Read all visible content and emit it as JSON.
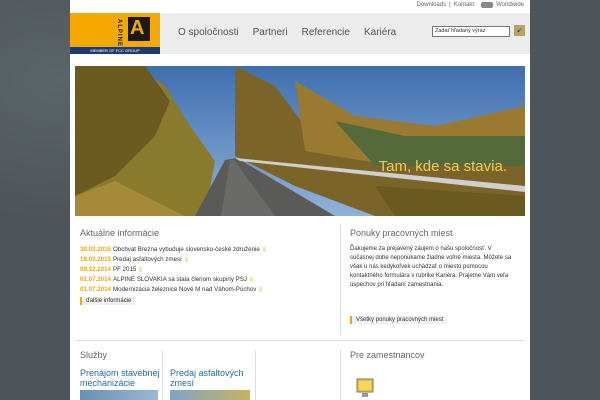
{
  "toplinks": {
    "downloads": "Downloads",
    "sep": "|",
    "contact": "Kontakt",
    "worldwide": "Worldwide"
  },
  "logo": {
    "name": "ALPINE",
    "member": "MEMBER OF FCC GROUP"
  },
  "nav": {
    "items": [
      "O spoločnosti",
      "Partneri",
      "Referencie",
      "Kariéra"
    ]
  },
  "search": {
    "placeholder": "Zadať hľadaný výraz",
    "button": "↙"
  },
  "hero": {
    "caption": "Tam, kde sa stavia."
  },
  "news": {
    "title": "Aktuálne informácie",
    "items": [
      {
        "date": "30.03.2015",
        "text": "Obchvat Brezna vybuduje slovensko-české združenie"
      },
      {
        "date": "18.03.2015",
        "text": "Predaj asfaltových zmesí"
      },
      {
        "date": "09.12.2014",
        "text": "PF 2015"
      },
      {
        "date": "01.07.2014",
        "text": "ALPINE SLOVAKIA sa stala členom skupiny PSJ"
      },
      {
        "date": "01.07.2014",
        "text": "Modernizácia železnice Nové M nad Váhom-Púchov"
      }
    ],
    "more": "ďalšie informácie"
  },
  "jobs": {
    "title": "Ponuky pracovných miest",
    "text": "Ďakujeme za prejavený záujem o našu spoločnosť. V súčasnej dobe neponúkame žiadne voľné miesta. Môžete sa však u nás kedykoľvek uchádzať o miesto pomocou kontaktného formulára v rubrike Kariéra. Prajeme Vám veľa úspechov pri hľadaní zamestnania.",
    "all": "Všetky ponuky pracovných miest"
  },
  "services": {
    "title": "Služby",
    "item1": "Prenájom stavebnej mechanizácie",
    "item2": "Predaj asfaltových zmesí"
  },
  "employees": {
    "title": "Pre zamestnancov"
  },
  "colors": {
    "accent": "#f5a800",
    "link": "#2b6aa5",
    "bg": "#4d555a"
  }
}
